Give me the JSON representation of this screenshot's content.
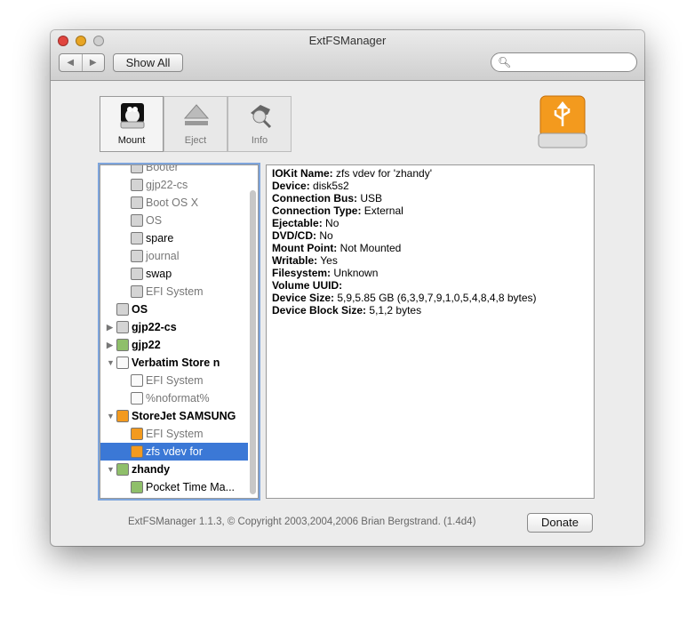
{
  "window": {
    "title": "ExtFSManager"
  },
  "toolbar": {
    "show_all": "Show All",
    "back": "◀",
    "forward": "▶",
    "search_placeholder": ""
  },
  "tools": [
    {
      "label": "Mount",
      "icon": "tux-disk-icon",
      "selected": true
    },
    {
      "label": "Eject",
      "icon": "eject-icon"
    },
    {
      "label": "Info",
      "icon": "info-magnifier-icon"
    }
  ],
  "tree": [
    {
      "label": "Booter",
      "level": 1,
      "dim": true,
      "icon": "disk"
    },
    {
      "label": "gjp22-cs",
      "level": 1,
      "dim": true,
      "icon": "disk"
    },
    {
      "label": "Boot OS X",
      "level": 1,
      "dim": true,
      "icon": "disk"
    },
    {
      "label": "OS",
      "level": 1,
      "dim": true,
      "icon": "disk"
    },
    {
      "label": "spare",
      "level": 1,
      "icon": "disk"
    },
    {
      "label": "journal",
      "level": 1,
      "dim": true,
      "icon": "disk"
    },
    {
      "label": "swap",
      "level": 1,
      "icon": "disk"
    },
    {
      "label": "EFI System",
      "level": 1,
      "dim": true,
      "icon": "disk"
    },
    {
      "label": "OS",
      "level": 0,
      "bold": true,
      "icon": "disk",
      "expander": ""
    },
    {
      "label": "gjp22-cs",
      "level": 0,
      "bold": true,
      "icon": "disk",
      "expander": "▶"
    },
    {
      "label": "gjp22",
      "level": 0,
      "bold": true,
      "icon": "green",
      "expander": "▶"
    },
    {
      "label": "Verbatim Store n",
      "level": 0,
      "bold": true,
      "icon": "white",
      "expander": "▼"
    },
    {
      "label": "EFI System",
      "level": 1,
      "dim": true,
      "icon": "white"
    },
    {
      "label": "%noformat%",
      "level": 1,
      "dim": true,
      "icon": "white"
    },
    {
      "label": "StoreJet SAMSUNG",
      "level": 0,
      "bold": true,
      "icon": "orange",
      "expander": "▼"
    },
    {
      "label": "EFI System",
      "level": 1,
      "dim": true,
      "icon": "orange"
    },
    {
      "label": "zfs vdev for",
      "level": 1,
      "icon": "orange",
      "selected": true
    },
    {
      "label": "zhandy",
      "level": 0,
      "bold": true,
      "icon": "green",
      "expander": "▼"
    },
    {
      "label": "Pocket Time Ma...",
      "level": 1,
      "icon": "green"
    }
  ],
  "details": [
    {
      "key": "IOKit Name:",
      "value": " zfs vdev for 'zhandy'"
    },
    {
      "key": "Device:",
      "value": " disk5s2"
    },
    {
      "key": "Connection Bus:",
      "value": " USB"
    },
    {
      "key": "Connection Type:",
      "value": " External"
    },
    {
      "key": "Ejectable:",
      "value": " No"
    },
    {
      "key": "DVD/CD:",
      "value": " No"
    },
    {
      "key": "Mount Point:",
      "value": " Not Mounted"
    },
    {
      "key": "Writable:",
      "value": " Yes"
    },
    {
      "key": "Filesystem:",
      "value": " Unknown"
    },
    {
      "key": "Volume UUID:",
      "value": ""
    },
    {
      "key": "Device Size:",
      "value": " 5,9,5.85 GB (6,3,9,7,9,1,0,5,4,8,4,8 bytes)"
    },
    {
      "key": "Device Block Size:",
      "value": " 5,1,2 bytes"
    }
  ],
  "footer": {
    "text": "ExtFSManager 1.1.3, © Copyright 2003,2004,2006 Brian Bergstrand. (1.4d4)",
    "donate": "Donate"
  },
  "colors": {
    "selection": "#3b78d6",
    "usb_orange": "#f39a1e",
    "close": "#e0443e",
    "minimize": "#e8a524",
    "zoom": "#c8c8c8"
  }
}
